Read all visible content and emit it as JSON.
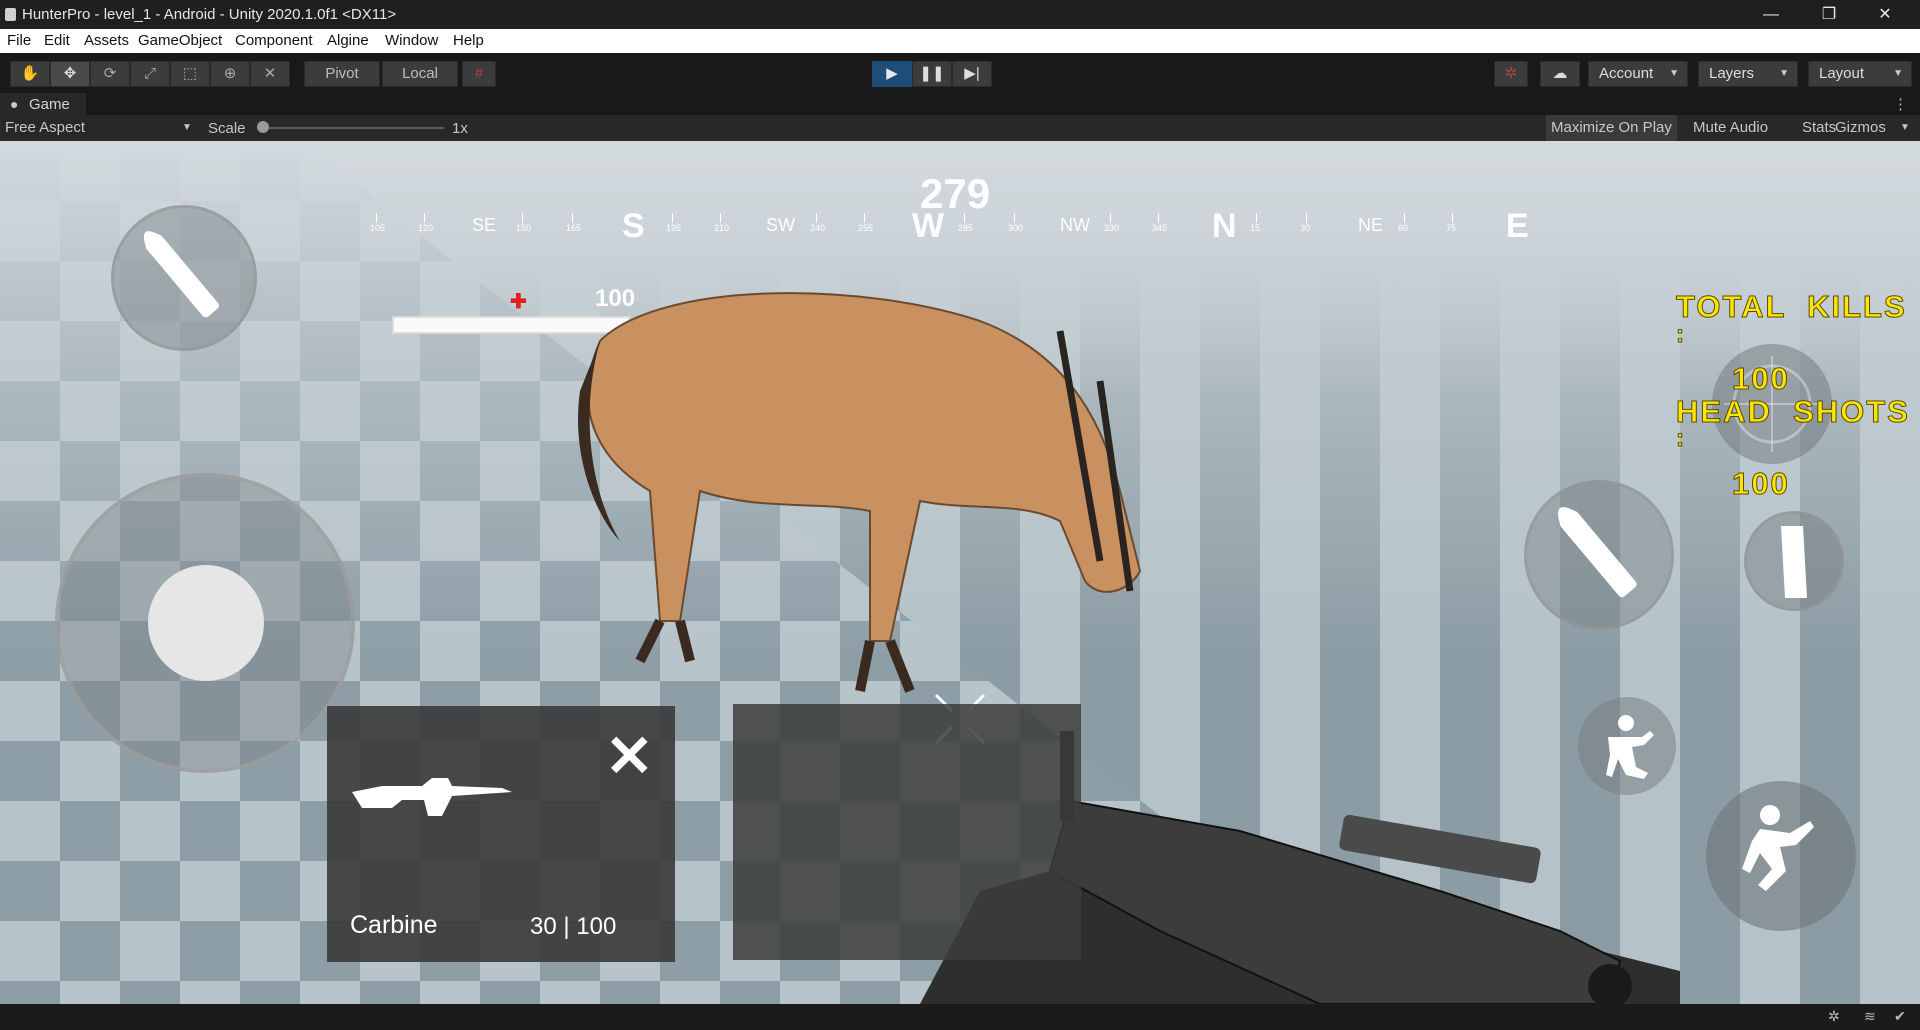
{
  "window": {
    "title": "HunterPro - level_1 - Android - Unity 2020.1.0f1 <DX11>",
    "minimize": "—",
    "restore": "❐",
    "close": "✕"
  },
  "menu": [
    "File",
    "Edit",
    "Assets",
    "GameObject",
    "Component",
    "Algine",
    "Window",
    "Help"
  ],
  "toolbar": {
    "pivot": "Pivot",
    "local": "Local",
    "account": "Account",
    "layers": "Layers",
    "layout": "Layout"
  },
  "game_tab": {
    "label": "Game",
    "aspect": "Free Aspect",
    "scale_label": "Scale",
    "scale_value": "1x",
    "maximize_on_play": "Maximize On Play",
    "mute_audio": "Mute Audio",
    "stats": "Stats",
    "gizmos": "Gizmos"
  },
  "hud": {
    "heading": "279",
    "compass_major": [
      {
        "label": "SE",
        "deg": "150"
      },
      {
        "label": "S",
        "deg": "180"
      },
      {
        "label": "SW",
        "deg": "210"
      },
      {
        "label": "W",
        "deg": "270"
      },
      {
        "label": "NW",
        "deg": "300"
      },
      {
        "label": "N",
        "deg": "0"
      },
      {
        "label": "NE",
        "deg": "45"
      },
      {
        "label": "E",
        "deg": "90"
      }
    ],
    "compass_minor": [
      "105",
      "120",
      "150",
      "165",
      "195",
      "210",
      "240",
      "255",
      "285",
      "300",
      "330",
      "345",
      "15",
      "30",
      "60",
      "75"
    ],
    "health_value": "100",
    "health_fraction": 1.0,
    "total_kills_label": "TOTAL  KILLS",
    "total_kills_colon": ":",
    "total_kills_value": "100",
    "head_shots_label": "HEAD  SHOTS",
    "head_shots_colon": ":",
    "head_shots_value": "100",
    "weapon_name": "Carbine",
    "ammo": "30 | 100"
  },
  "colors": {
    "editor_bg": "#191919",
    "play_active": "#1e4d78",
    "hud_yellow": "#ffe600"
  }
}
